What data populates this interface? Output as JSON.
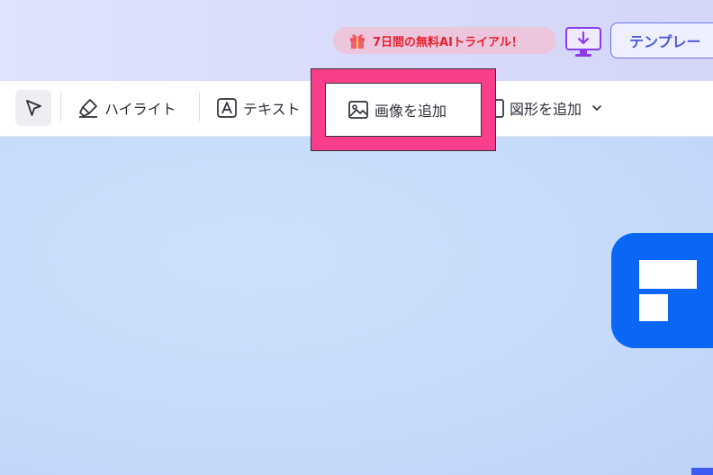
{
  "header": {
    "trial_label": "7日間の無料AIトライアル！",
    "template_label": "テンプレー",
    "colors": {
      "trial_text": "#e8202f",
      "trial_pill_bg": "#ecc6dc",
      "template_border": "#6b78e8",
      "download_icon": "#8a3cf0"
    }
  },
  "toolbar": {
    "select_icon": "cursor-arrow-icon",
    "highlight_label": "ハイライト",
    "text_label": "テキスト",
    "add_image_label": "画像を追加",
    "add_shape_label": "図形を追加",
    "colors": {
      "emphasis_frame": "#fb3e8c"
    }
  },
  "canvas": {
    "logo": "app-logo-icon",
    "colors": {
      "logo_bg": "#0a66f5"
    }
  }
}
